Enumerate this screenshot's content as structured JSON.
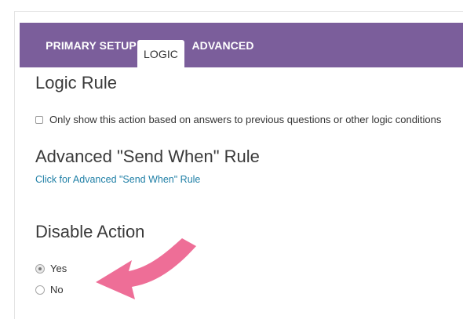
{
  "tabs": {
    "primary_setup": "PRIMARY SETUP",
    "logic": "LOGIC",
    "advanced": "ADVANCED"
  },
  "logic_rule": {
    "title": "Logic Rule",
    "checkbox_label": "Only show this action based on answers to previous questions or other logic conditions"
  },
  "send_when": {
    "title": "Advanced \"Send When\" Rule",
    "link": "Click for Advanced \"Send When\" Rule"
  },
  "disable_action": {
    "title": "Disable Action",
    "options": [
      {
        "label": "Yes",
        "selected": true
      },
      {
        "label": "No",
        "selected": false
      }
    ]
  },
  "colors": {
    "tab_bar": "#7b5e9b",
    "link": "#1f7fa6",
    "annotation_arrow": "#ee6e97"
  },
  "annotation": {
    "icon": "arrow-annotation-icon"
  }
}
